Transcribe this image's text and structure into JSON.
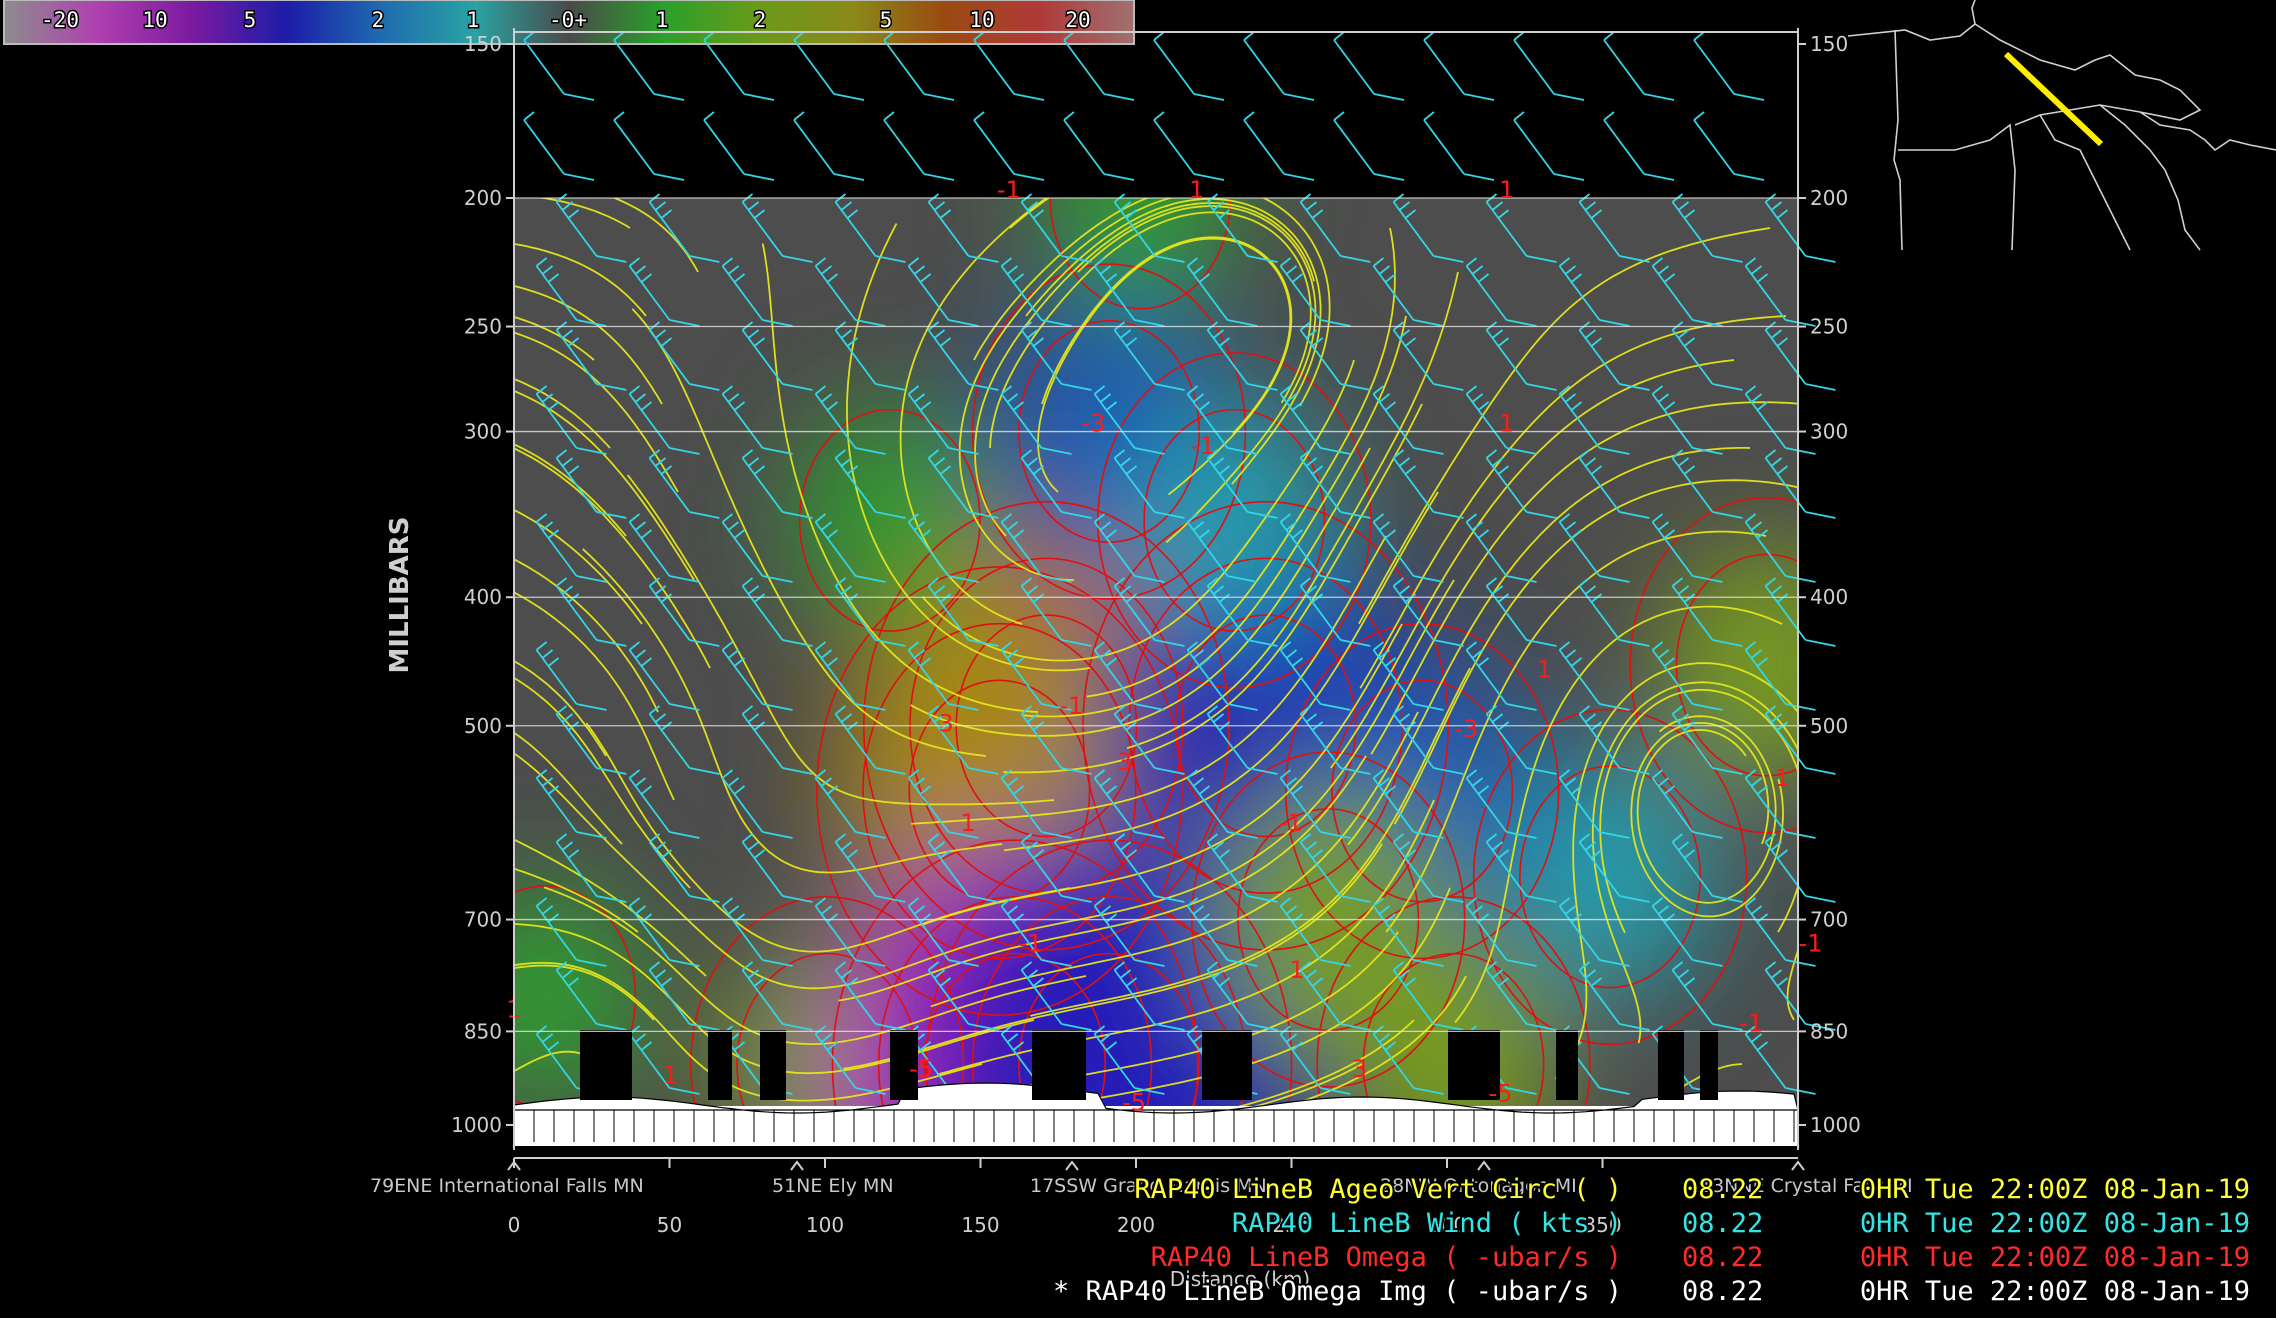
{
  "colorbar": {
    "labels": [
      "-20",
      "10",
      "5",
      "2",
      "1",
      "-0+",
      "1",
      "2",
      "5",
      "10",
      "20"
    ],
    "colors": [
      "#8c8c8c",
      "#b040b0",
      "#7a1aa0",
      "#1c1ca8",
      "#1f6ab0",
      "#29a3a3",
      "#4a4a4a",
      "#2aa02a",
      "#6a9a1a",
      "#8a8a1a",
      "#9a4a10",
      "#b03a3a",
      "#a07070"
    ]
  },
  "yaxis": {
    "title": "MILLIBARS",
    "ticks": [
      "150",
      "200",
      "250",
      "300",
      "400",
      "500",
      "700",
      "850",
      "1000"
    ],
    "right_ticks": [
      "150",
      "200",
      "250",
      "300",
      "400",
      "500",
      "700",
      "850",
      "1000"
    ]
  },
  "xaxis": {
    "title": "Distance (km)",
    "ticks": [
      "0",
      "50",
      "100",
      "150",
      "200",
      "250",
      "300",
      "350"
    ]
  },
  "locations": [
    "79ENE International Falls MN",
    "51NE Ely MN",
    "17SSW Grand Marais MN",
    "28NW Ontonagon MI",
    "13NNE Crystal Falls MI"
  ],
  "omega_labels": [
    "-1",
    "1",
    "1",
    "-3",
    "-1",
    "1",
    "3",
    "-1",
    "3",
    "-3",
    "1",
    "1",
    "1",
    "-1",
    "-1",
    "1",
    "1",
    "-1",
    "-1",
    "1",
    "1",
    "-5",
    "3",
    "-5",
    "-5"
  ],
  "legend": [
    {
      "text": "RAP40 LineB Ageo Vert Circ (  )",
      "value": "08.22",
      "time": "0HR Tue 22:00Z 08-Jan-19",
      "color": "#ffff33"
    },
    {
      "text": "RAP40 LineB Wind ( kts )",
      "value": "08.22",
      "time": "0HR Tue 22:00Z 08-Jan-19",
      "color": "#33e6e6"
    },
    {
      "text": "RAP40 LineB Omega ( -ubar/s )",
      "value": "08.22",
      "time": "0HR Tue 22:00Z 08-Jan-19",
      "color": "#ff2a2a"
    },
    {
      "text": "* RAP40 LineB Omega Img ( -ubar/s )",
      "value": "08.22",
      "time": "0HR Tue 22:00Z 08-Jan-19",
      "color": "#ffffff"
    }
  ],
  "style": {
    "background": "#000000",
    "plot_bg": "#4d4d4d",
    "axis": "#cfcfcf",
    "streamline": "#e6e61a",
    "barb": "#33d6e6",
    "contour": "#e01010",
    "map_line": "#d0d0d0",
    "cross_section_line": "#ffee00"
  },
  "chart_data": {
    "type": "heatmap",
    "title": "",
    "xlabel": "Distance (km)",
    "ylabel": "MILLIBARS",
    "xlim": [
      0,
      410
    ],
    "ylim": [
      1000,
      150
    ],
    "y_scale": "log",
    "grid": true,
    "pressure_levels": [
      150,
      200,
      250,
      300,
      400,
      500,
      700,
      850,
      1000
    ],
    "omega_centers": [
      {
        "x": 170,
        "p": 500,
        "value": 10
      },
      {
        "x": 155,
        "p": 560,
        "value": 6
      },
      {
        "x": 100,
        "p": 900,
        "value": 2
      },
      {
        "x": 160,
        "p": 900,
        "value": -12
      },
      {
        "x": 190,
        "p": 900,
        "value": -8
      },
      {
        "x": 240,
        "p": 500,
        "value": -6
      },
      {
        "x": 290,
        "p": 560,
        "value": -3
      },
      {
        "x": 190,
        "p": 300,
        "value": -3
      },
      {
        "x": 230,
        "p": 350,
        "value": -2
      },
      {
        "x": 260,
        "p": 700,
        "value": 3
      },
      {
        "x": 300,
        "p": 900,
        "value": 2
      },
      {
        "x": 400,
        "p": 450,
        "value": 2
      },
      {
        "x": 120,
        "p": 350,
        "value": 1.5
      },
      {
        "x": 200,
        "p": 200,
        "value": 1.5
      },
      {
        "x": 350,
        "p": 650,
        "value": -2
      },
      {
        "x": 10,
        "p": 800,
        "value": 1.5
      }
    ],
    "omega_contour_labels": [
      {
        "x": 158,
        "p": 200,
        "text": "-1"
      },
      {
        "x": 218,
        "p": 200,
        "text": "1"
      },
      {
        "x": 317,
        "p": 200,
        "text": "1"
      },
      {
        "x": 185,
        "p": 300,
        "text": "-3"
      },
      {
        "x": 220,
        "p": 312,
        "text": "-1"
      },
      {
        "x": 317,
        "p": 300,
        "text": "1"
      },
      {
        "x": 138,
        "p": 505,
        "text": "3"
      },
      {
        "x": 178,
        "p": 490,
        "text": "-1"
      },
      {
        "x": 195,
        "p": 540,
        "text": "3"
      },
      {
        "x": 304,
        "p": 510,
        "text": "-3"
      },
      {
        "x": 329,
        "p": 460,
        "text": "1"
      },
      {
        "x": 405,
        "p": 555,
        "text": "1"
      },
      {
        "x": 145,
        "p": 600,
        "text": "1"
      },
      {
        "x": 248,
        "p": 600,
        "text": "-1"
      },
      {
        "x": 165,
        "p": 740,
        "text": "-1"
      },
      {
        "x": 250,
        "p": 775,
        "text": "1"
      },
      {
        "x": 0,
        "p": 830,
        "text": "1"
      },
      {
        "x": 395,
        "p": 850,
        "text": "-1"
      },
      {
        "x": 414,
        "p": 740,
        "text": "-1"
      },
      {
        "x": 50,
        "p": 930,
        "text": "1"
      },
      {
        "x": 270,
        "p": 920,
        "text": "3"
      },
      {
        "x": 130,
        "p": 920,
        "text": "-5"
      },
      {
        "x": 198,
        "p": 975,
        "text": "-5"
      },
      {
        "x": 315,
        "p": 960,
        "text": "-5"
      }
    ]
  }
}
